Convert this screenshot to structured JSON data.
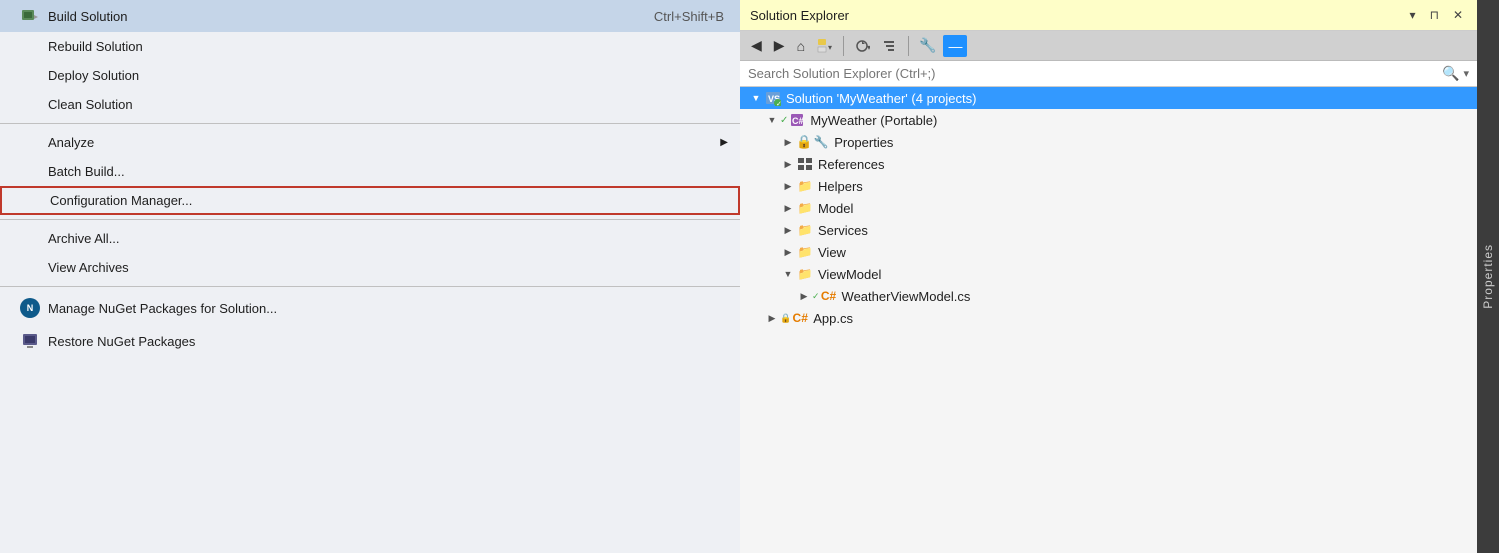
{
  "menu": {
    "items": [
      {
        "id": "build-solution",
        "label": "Build Solution",
        "shortcut": "Ctrl+Shift+B",
        "hasIcon": true,
        "iconType": "build"
      },
      {
        "id": "rebuild-solution",
        "label": "Rebuild Solution",
        "shortcut": "",
        "hasIcon": false
      },
      {
        "id": "deploy-solution",
        "label": "Deploy Solution",
        "shortcut": "",
        "hasIcon": false
      },
      {
        "id": "clean-solution",
        "label": "Clean Solution",
        "shortcut": "",
        "hasIcon": false
      },
      {
        "id": "analyze",
        "label": "Analyze",
        "shortcut": "",
        "hasIcon": false,
        "hasArrow": true
      },
      {
        "id": "batch-build",
        "label": "Batch Build...",
        "shortcut": "",
        "hasIcon": false
      },
      {
        "id": "configuration-manager",
        "label": "Configuration Manager...",
        "shortcut": "",
        "hasIcon": false,
        "highlighted": true
      },
      {
        "id": "archive-all",
        "label": "Archive All...",
        "shortcut": "",
        "hasIcon": false
      },
      {
        "id": "view-archives",
        "label": "View Archives",
        "shortcut": "",
        "hasIcon": false
      },
      {
        "id": "manage-nuget",
        "label": "Manage NuGet Packages for Solution...",
        "shortcut": "",
        "hasIcon": true,
        "iconType": "nuget"
      },
      {
        "id": "restore-nuget",
        "label": "Restore NuGet Packages",
        "shortcut": "",
        "hasIcon": true,
        "iconType": "restore"
      }
    ]
  },
  "solutionExplorer": {
    "title": "Solution Explorer",
    "searchPlaceholder": "Search Solution Explorer (Ctrl+;)",
    "toolbar": {
      "buttons": [
        "◀",
        "▶",
        "⌂",
        "📁▾",
        "⏱▾",
        "📋",
        "🔧",
        "—"
      ]
    },
    "tree": {
      "items": [
        {
          "id": "solution",
          "label": "Solution 'MyWeather' (4 projects)",
          "indent": 0,
          "expanded": true,
          "selected": true,
          "iconType": "solution"
        },
        {
          "id": "myweather",
          "label": "MyWeather (Portable)",
          "indent": 1,
          "expanded": true,
          "selected": false,
          "iconType": "csharp"
        },
        {
          "id": "properties",
          "label": "Properties",
          "indent": 2,
          "expanded": false,
          "selected": false,
          "iconType": "properties"
        },
        {
          "id": "references",
          "label": "References",
          "indent": 2,
          "expanded": false,
          "selected": false,
          "iconType": "references"
        },
        {
          "id": "helpers",
          "label": "Helpers",
          "indent": 2,
          "expanded": false,
          "selected": false,
          "iconType": "folder"
        },
        {
          "id": "model",
          "label": "Model",
          "indent": 2,
          "expanded": false,
          "selected": false,
          "iconType": "folder"
        },
        {
          "id": "services",
          "label": "Services",
          "indent": 2,
          "expanded": false,
          "selected": false,
          "iconType": "folder"
        },
        {
          "id": "view",
          "label": "View",
          "indent": 2,
          "expanded": false,
          "selected": false,
          "iconType": "folder"
        },
        {
          "id": "viewmodel",
          "label": "ViewModel",
          "indent": 2,
          "expanded": true,
          "selected": false,
          "iconType": "folder"
        },
        {
          "id": "weatherviewmodel",
          "label": "WeatherViewModel.cs",
          "indent": 3,
          "expanded": false,
          "selected": false,
          "iconType": "cs-file"
        },
        {
          "id": "app",
          "label": "App.cs",
          "indent": 1,
          "expanded": false,
          "selected": false,
          "iconType": "cs-file-lock"
        }
      ]
    }
  },
  "properties": {
    "label": "Properties"
  }
}
